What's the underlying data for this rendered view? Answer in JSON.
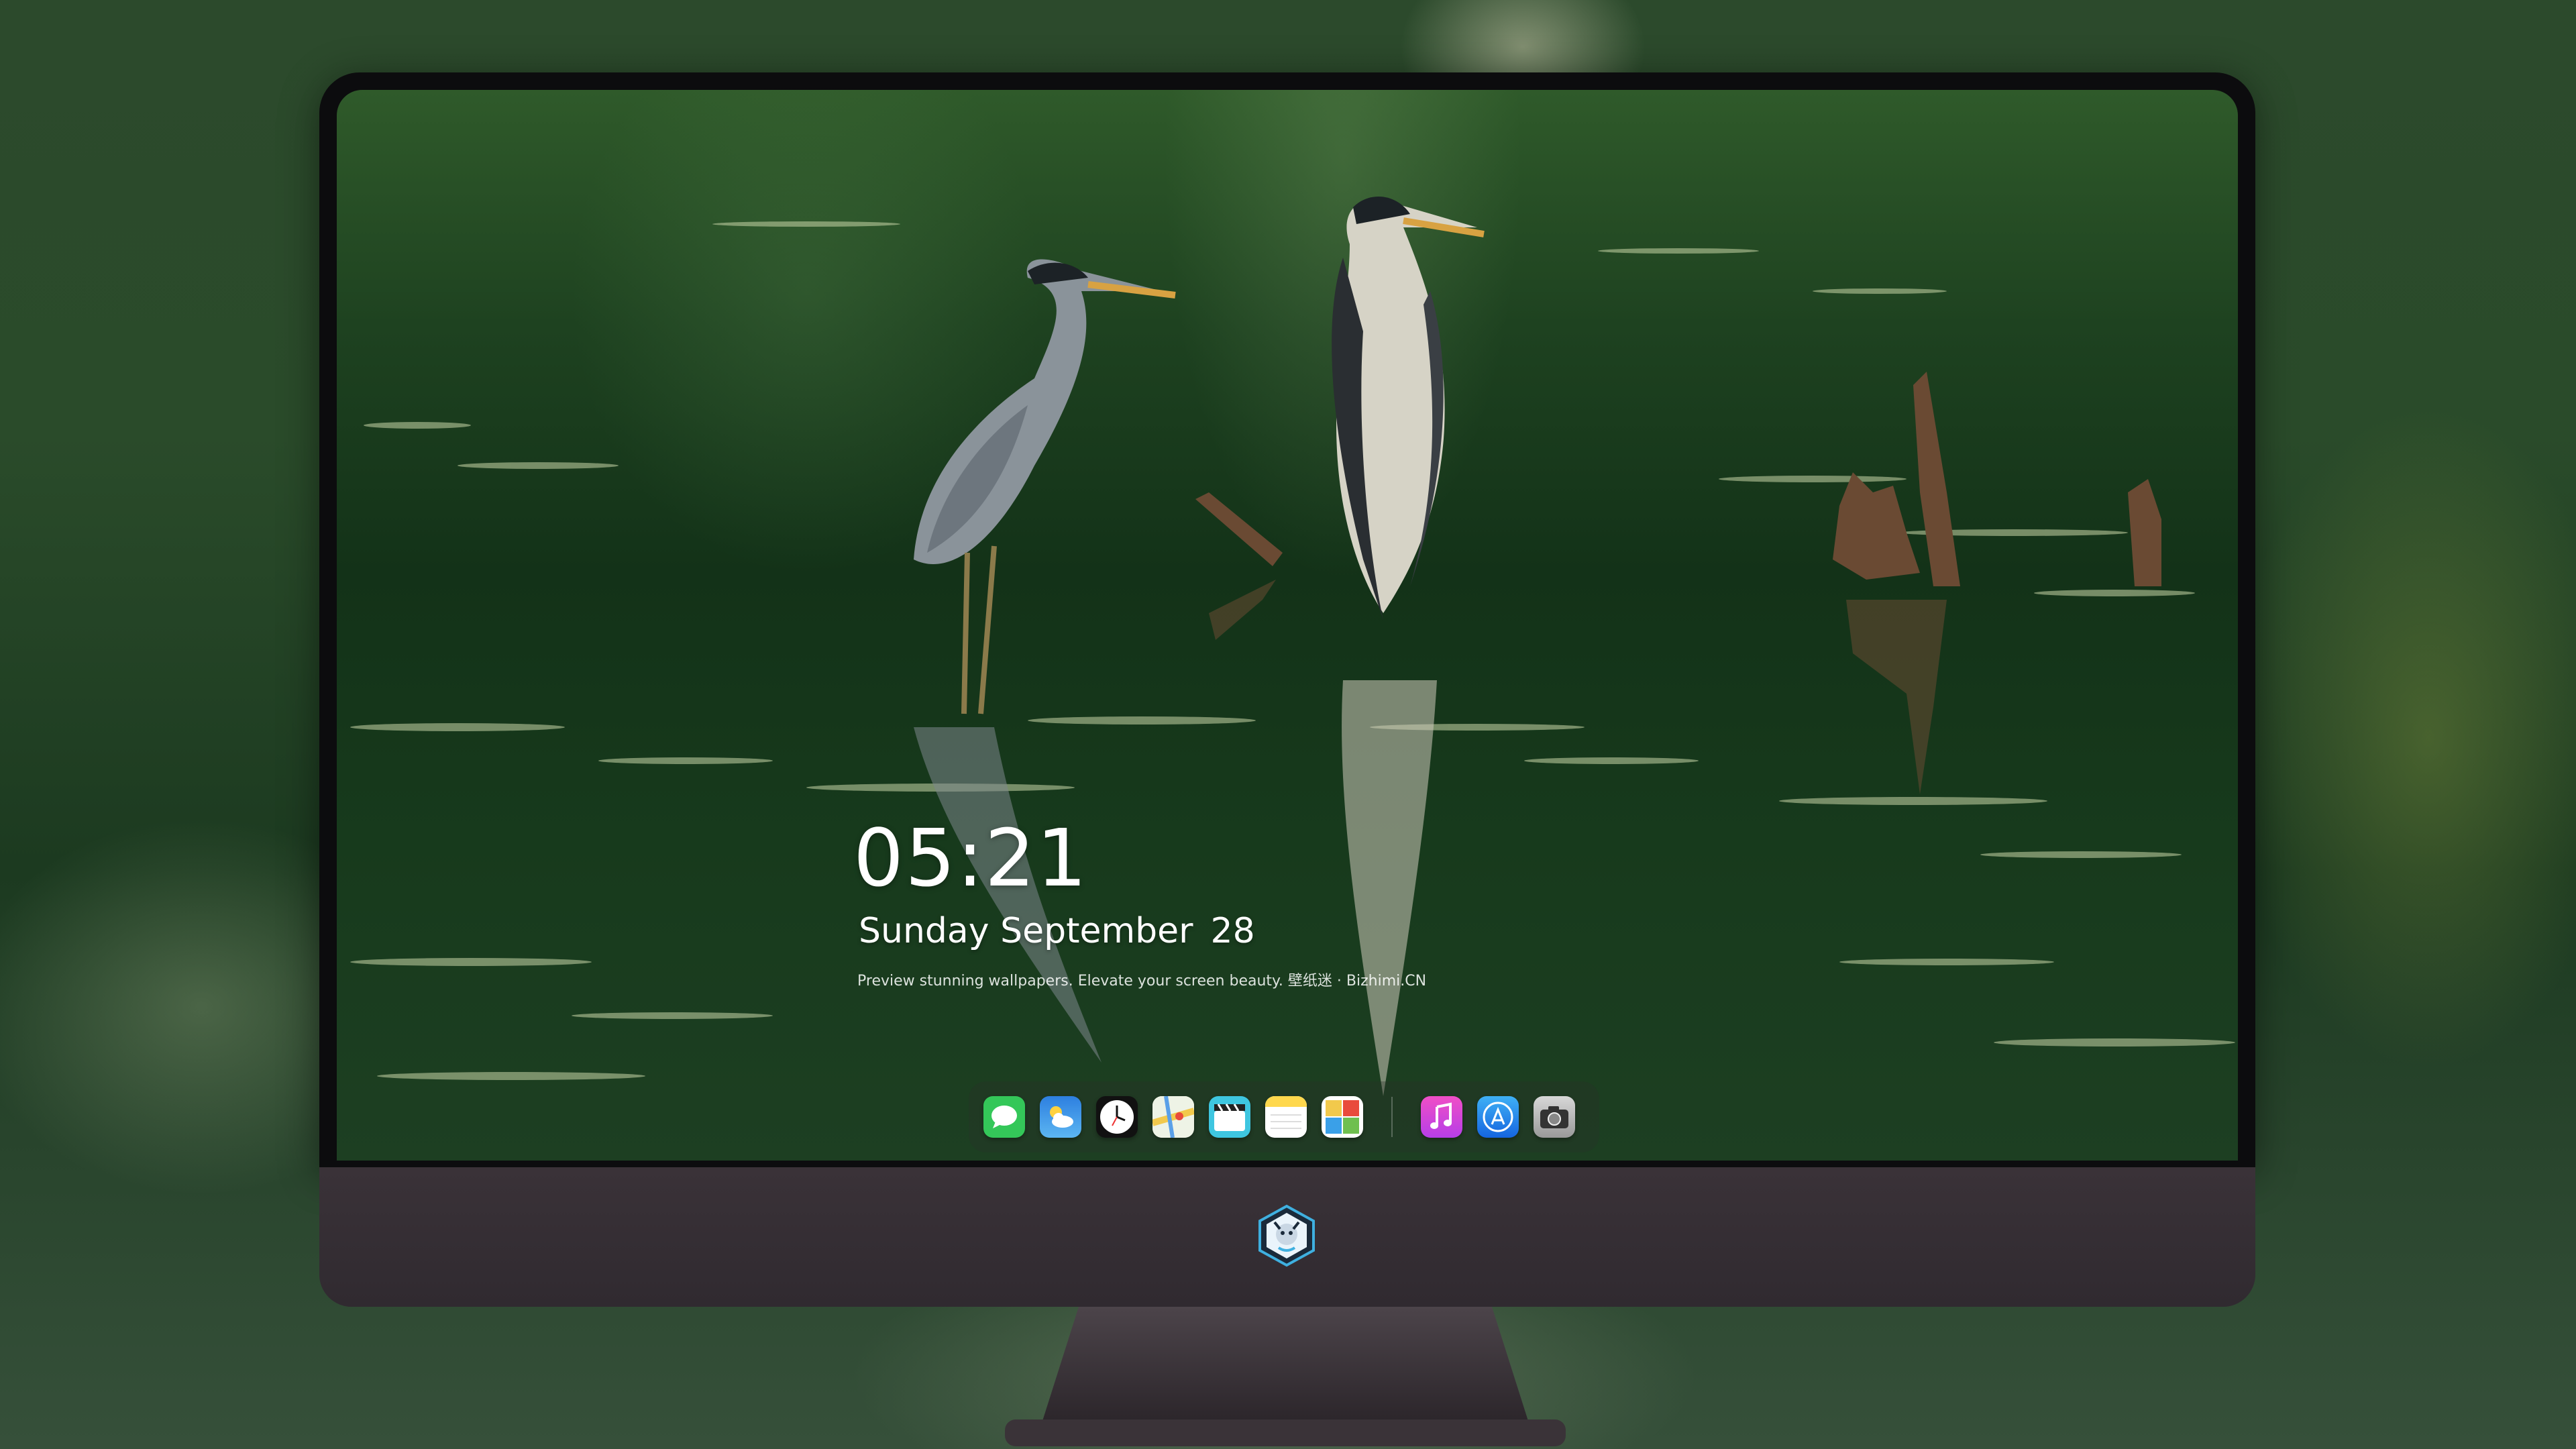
{
  "lock_screen": {
    "time": "05:21",
    "date_text": "Sunday September",
    "date_day": "28",
    "tagline": "Preview stunning wallpapers. Elevate your screen beauty. 壁纸迷 · Bizhimi.CN"
  },
  "dock": {
    "apps": [
      {
        "name": "messages",
        "icon": "messages-icon",
        "color": "#34c759"
      },
      {
        "name": "weather",
        "icon": "weather-icon",
        "color": "#2f8fe8"
      },
      {
        "name": "clock",
        "icon": "clock-icon",
        "color": "#ffffff"
      },
      {
        "name": "maps",
        "icon": "maps-icon",
        "color": "#f2c94c"
      },
      {
        "name": "clips",
        "icon": "clips-icon",
        "color": "#3ec6e0"
      },
      {
        "name": "notes",
        "icon": "notes-icon",
        "color": "#ffd84d"
      },
      {
        "name": "photos",
        "icon": "photos-icon",
        "color": "#6fbf4f"
      },
      {
        "name": "music",
        "icon": "music-icon",
        "color": "#d93fe0"
      },
      {
        "name": "app-store",
        "icon": "app-store-icon",
        "color": "#1e88f0"
      },
      {
        "name": "camera",
        "icon": "camera-icon",
        "color": "#555555"
      }
    ]
  },
  "monitor": {
    "logo_icon": "mascot-logo-icon"
  }
}
